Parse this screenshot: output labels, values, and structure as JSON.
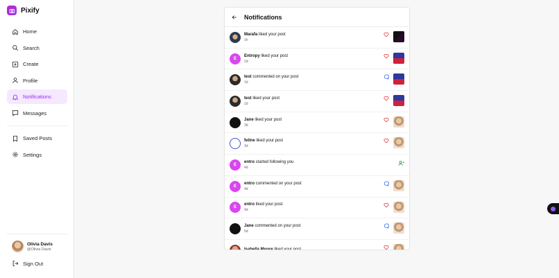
{
  "brand": {
    "name": "Pixify"
  },
  "nav": {
    "items": [
      {
        "label": "Home",
        "icon": "home-icon"
      },
      {
        "label": "Search",
        "icon": "search-icon"
      },
      {
        "label": "Create",
        "icon": "plus-square-icon"
      },
      {
        "label": "Profile",
        "icon": "user-icon"
      },
      {
        "label": "Notifications",
        "icon": "bell-icon",
        "active": true
      },
      {
        "label": "Messages",
        "icon": "message-icon"
      }
    ],
    "secondary": [
      {
        "label": "Saved Posts",
        "icon": "bookmark-icon"
      },
      {
        "label": "Settings",
        "icon": "gear-icon"
      }
    ]
  },
  "user": {
    "name": "Olivia Davis",
    "handle": "@Olivia Davis"
  },
  "signout": {
    "label": "Sign Out"
  },
  "panel": {
    "title": "Notifications"
  },
  "notifications": [
    {
      "user": "Marafa",
      "action": "liked your post",
      "time": "1h",
      "type": "like",
      "avatar_initial": ""
    },
    {
      "user": "Entropy",
      "action": "liked your post",
      "time": "1d",
      "type": "like",
      "avatar_initial": "E"
    },
    {
      "user": "test",
      "action": "commented on your post",
      "time": "1d",
      "type": "comment",
      "avatar_initial": ""
    },
    {
      "user": "test",
      "action": "liked your post",
      "time": "1d",
      "type": "like",
      "avatar_initial": ""
    },
    {
      "user": "Jane",
      "action": "liked your post",
      "time": "3d",
      "type": "like",
      "avatar_initial": ""
    },
    {
      "user": "feline",
      "action": "liked your post",
      "time": "3d",
      "type": "like",
      "avatar_initial": ""
    },
    {
      "user": "entro",
      "action": "started following you",
      "time": "4d",
      "type": "follow",
      "avatar_initial": "E"
    },
    {
      "user": "entro",
      "action": "commented on your post",
      "time": "4d",
      "type": "comment",
      "avatar_initial": "E"
    },
    {
      "user": "entro",
      "action": "liked your post",
      "time": "4d",
      "type": "like",
      "avatar_initial": "E"
    },
    {
      "user": "Jane",
      "action": "commented on your post",
      "time": "5d",
      "type": "comment",
      "avatar_initial": ""
    },
    {
      "user": "Isabella Moore",
      "action": "liked your post",
      "time": "",
      "type": "like",
      "avatar_initial": ""
    }
  ],
  "colors": {
    "accent": "#9333ea",
    "like": "#dc2626",
    "comment": "#2563eb",
    "follow": "#16a34a"
  }
}
